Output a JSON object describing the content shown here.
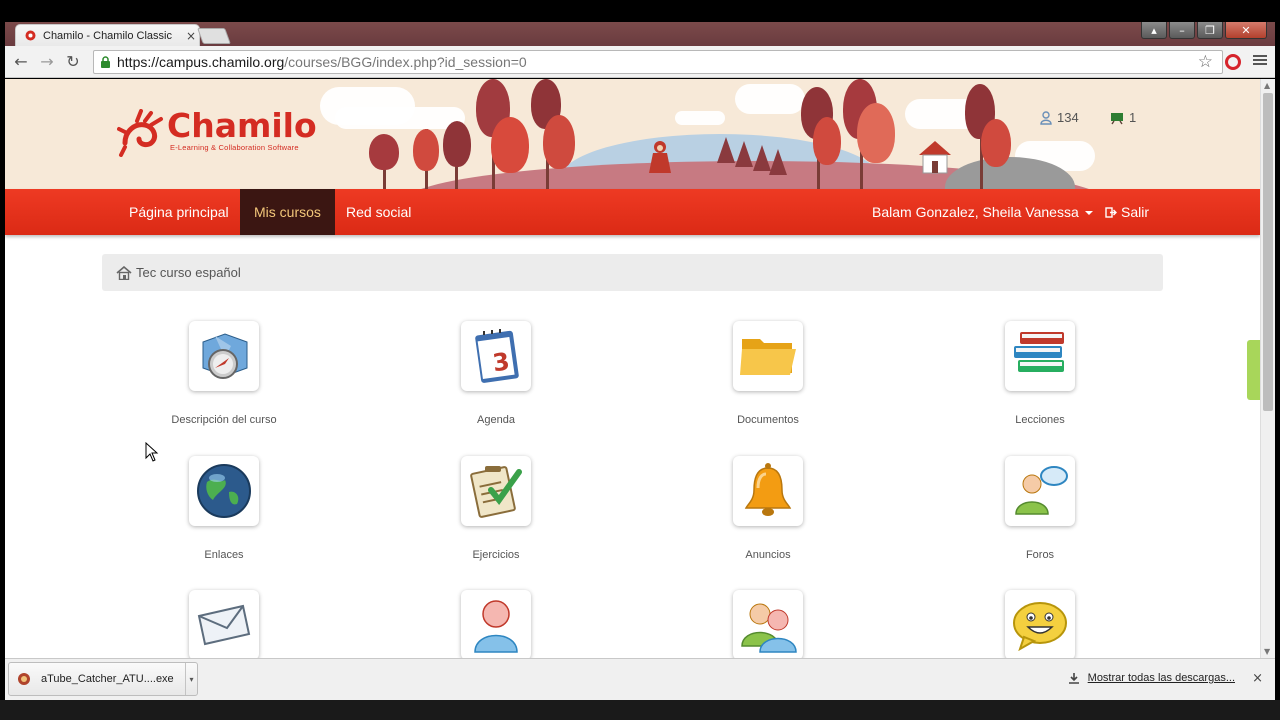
{
  "browser": {
    "tab_title": "Chamilo - Chamilo Classic",
    "tab_close": "×",
    "url_host": "https://campus.chamilo.org",
    "url_path": "/courses/BGG/index.php?id_session=0",
    "window_buttons": [
      "▴",
      "–",
      "❐",
      "✕"
    ]
  },
  "header": {
    "brand": "Chamilo",
    "tagline": "E-Learning & Collaboration Software",
    "users_online": "134",
    "messages_count": "1"
  },
  "navbar": {
    "items": [
      {
        "label": "Página principal"
      },
      {
        "label": "Mis cursos"
      },
      {
        "label": "Red social"
      }
    ],
    "user_name": "Balam Gonzalez, Sheila Vanessa",
    "logout_label": "Salir"
  },
  "breadcrumb": {
    "course": "Tec curso español"
  },
  "tools": [
    {
      "label": "Descripción del curso",
      "icon": "compass-map-icon"
    },
    {
      "label": "Agenda",
      "icon": "calendar-icon"
    },
    {
      "label": "Documentos",
      "icon": "folder-icon"
    },
    {
      "label": "Lecciones",
      "icon": "books-icon"
    },
    {
      "label": "Enlaces",
      "icon": "globe-icon"
    },
    {
      "label": "Ejercicios",
      "icon": "checklist-icon"
    },
    {
      "label": "Anuncios",
      "icon": "bell-icon"
    },
    {
      "label": "Foros",
      "icon": "forum-user-icon"
    },
    {
      "label": "",
      "icon": "envelope-icon"
    },
    {
      "label": "",
      "icon": "user-icon"
    },
    {
      "label": "",
      "icon": "group-icon"
    },
    {
      "label": "",
      "icon": "chat-smiley-icon"
    }
  ],
  "download_shelf": {
    "file_name": "aTube_Catcher_ATU....exe",
    "show_all": "Mostrar todas las descargas...",
    "close": "×"
  },
  "colors": {
    "brand_red": "#d42c22",
    "navbar_red": "#e8321c",
    "active_nav": "#3b1612",
    "active_nav_text": "#f3c77a"
  }
}
